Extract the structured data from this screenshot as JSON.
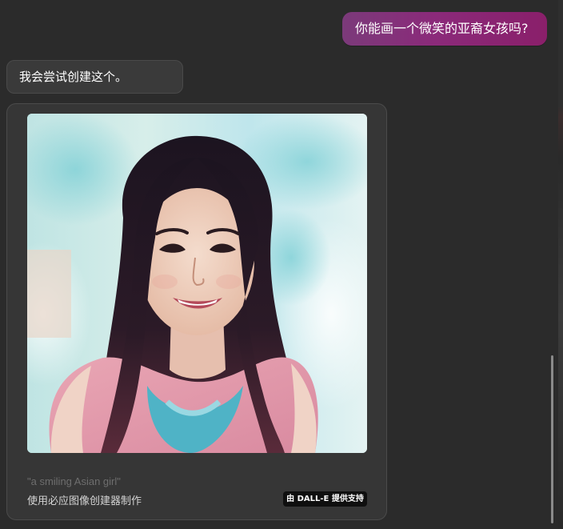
{
  "conversation": {
    "user_message": "你能画一个微笑的亚裔女孩吗?",
    "assistant_message": "我会尝试创建这个。",
    "image_card": {
      "image_subject": "smiling-asian-girl-portrait",
      "prompt_caption": "\"a smiling Asian girl\"",
      "creator_caption": "使用必应图像创建器制作",
      "badge_label": "由 DALL-E 提供支持"
    }
  },
  "colors": {
    "background": "#2b2b2b",
    "user_bubble_start": "#7b3a7a",
    "user_bubble_end": "#8a1f6a",
    "assistant_bubble": "#3a3a3a",
    "card_background": "#363636",
    "badge_background": "#0f0f0f"
  }
}
